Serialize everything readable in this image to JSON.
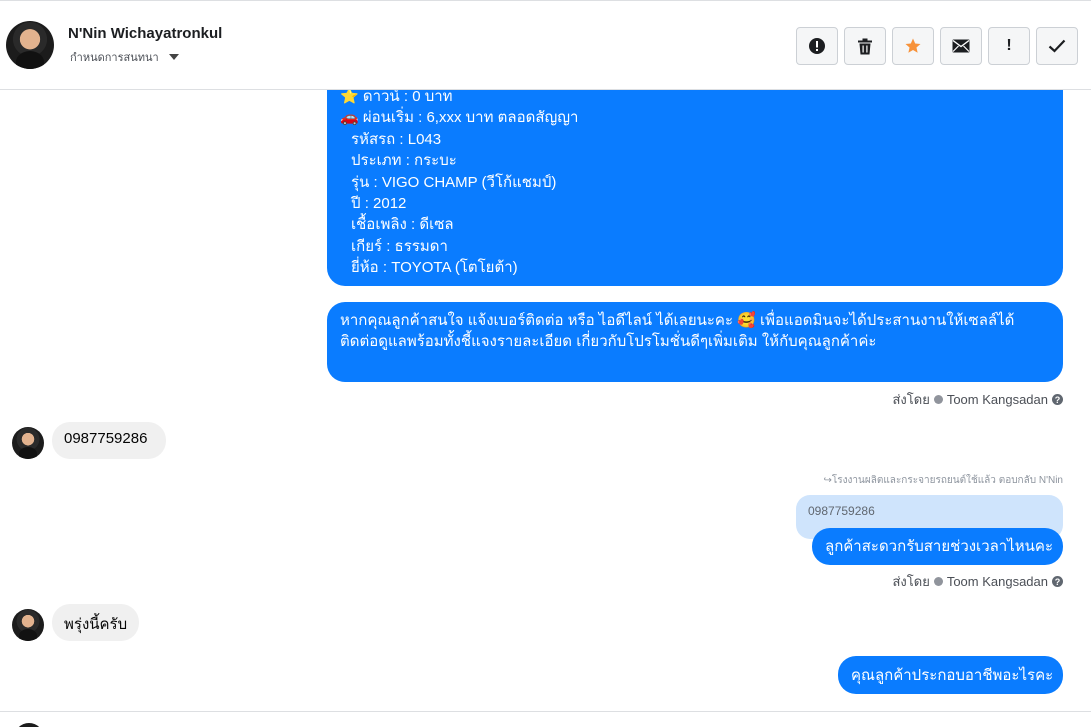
{
  "header": {
    "contact_name": "N'Nin Wichayatronkul",
    "assign_label": "กำหนดการสนทนา"
  },
  "toolbar": {
    "buttons": [
      {
        "name": "spam-alert",
        "icon": "alert-circle-icon",
        "glyph": ""
      },
      {
        "name": "delete",
        "icon": "trash-icon",
        "glyph": ""
      },
      {
        "name": "star",
        "icon": "star-icon",
        "glyph": "",
        "color": "#f7923a"
      },
      {
        "name": "mark-unread",
        "icon": "envelope-icon",
        "glyph": ""
      },
      {
        "name": "flag-important",
        "icon": "exclamation-icon",
        "glyph": "!"
      },
      {
        "name": "mark-done",
        "icon": "checkmark-icon",
        "glyph": ""
      }
    ]
  },
  "messages": {
    "car_details": [
      "⭐ ดาวน์ : 0 บาท",
      "🚗 ผ่อนเริ่ม : 6,xxx บาท ตลอดสัญญา",
      "รหัสรถ : L043",
      "ประเภท : กระบะ",
      "รุ่น : VIGO CHAMP (วีโก้แชมป์)",
      "ปี : 2012",
      "เชื้อเพลิง : ดีเซล",
      "เกียร์ : ธรรมดา",
      "ยี่ห้อ : TOYOTA (โตโยต้า)"
    ],
    "contact_request": "หากคุณลูกค้าสนใจ แจ้งเบอร์ติดต่อ หรือ ไอดีไลน์ ได้เลยนะคะ 🥰 เพื่อแอดมินจะได้ประสานงานให้เซลล์ได้ติดต่อดูแลพร้อมทั้งชี้แจงรายละเอียด เกี่ยวกับโปรโมชั่นดีๆเพิ่มเติม ให้กับคุณลูกค้าค่ะ",
    "sent_by_label": "ส่งโดย",
    "sender_name": "Toom Kangsadan",
    "customer_phone": "0987759286",
    "reply_note": "↪โรงงานผลิตและกระจายรถยนต์ใช้แล้ว ตอบกลับ N'Nin",
    "quoted_text": "0987759286",
    "ask_time": "ลูกค้าสะดวกรับสายช่วงเวลาไหนคะ",
    "customer_reply": "พรุ่งนี้ครับ",
    "ask_job": "คุณลูกค้าประกอบอาชีพอะไรคะ"
  },
  "colors": {
    "outgoing_bubble": "#0a7cff",
    "incoming_bubble": "#f0f0f0",
    "quote_bg": "#cfe4fc",
    "star": "#f7923a"
  }
}
